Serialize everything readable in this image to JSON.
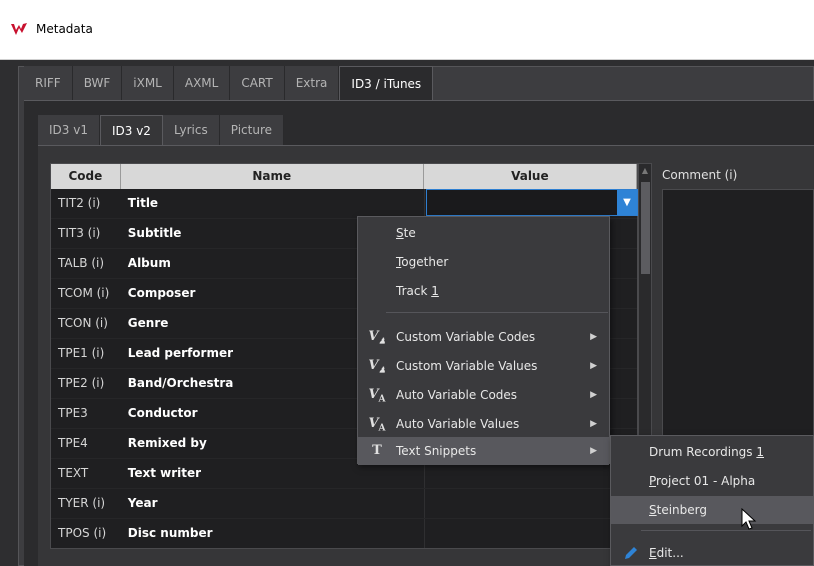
{
  "window": {
    "title": "Metadata"
  },
  "tabs": [
    "RIFF",
    "BWF",
    "iXML",
    "AXML",
    "CART",
    "Extra",
    "ID3 / iTunes"
  ],
  "active_tab": "ID3 / iTunes",
  "subtabs": [
    "ID3 v1",
    "ID3 v2",
    "Lyrics",
    "Picture"
  ],
  "active_subtab": "ID3 v2",
  "table": {
    "headers": {
      "code": "Code",
      "name": "Name",
      "value": "Value"
    },
    "rows": [
      {
        "code": "TIT2 (i)",
        "name": "Title"
      },
      {
        "code": "TIT3 (i)",
        "name": "Subtitle"
      },
      {
        "code": "TALB (i)",
        "name": "Album"
      },
      {
        "code": "TCOM (i)",
        "name": "Composer"
      },
      {
        "code": "TCON (i)",
        "name": "Genre"
      },
      {
        "code": "TPE1 (i)",
        "name": "Lead performer"
      },
      {
        "code": "TPE2 (i)",
        "name": "Band/Orchestra"
      },
      {
        "code": "TPE3",
        "name": "Conductor"
      },
      {
        "code": "TPE4",
        "name": "Remixed by"
      },
      {
        "code": "TEXT",
        "name": "Text writer"
      },
      {
        "code": "TYER (i)",
        "name": "Year"
      },
      {
        "code": "TPOS (i)",
        "name": "Disc number"
      }
    ]
  },
  "comment": {
    "label": "Comment (i)"
  },
  "menu": {
    "recent": [
      {
        "pre": "",
        "ul": "S",
        "post": "te"
      },
      {
        "pre": "",
        "ul": "T",
        "post": "ogether"
      },
      {
        "pre": "Track ",
        "ul": "1",
        "post": ""
      }
    ],
    "items": [
      {
        "label": "Custom Variable Codes",
        "icon": "custom-variable-icon"
      },
      {
        "label": "Custom Variable Values",
        "icon": "custom-variable-icon"
      },
      {
        "label": "Auto Variable Codes",
        "icon": "auto-variable-icon"
      },
      {
        "label": "Auto Variable Values",
        "icon": "auto-variable-icon"
      },
      {
        "label": "Text Snippets",
        "icon": "text-icon"
      }
    ]
  },
  "submenu": {
    "items": [
      {
        "pre": "Drum Recordings ",
        "ul": "1",
        "post": ""
      },
      {
        "pre": "",
        "ul": "P",
        "post": "roject 01 - Alpha"
      },
      {
        "pre": "",
        "ul": "S",
        "post": "teinberg"
      }
    ],
    "edit": {
      "pre": "",
      "ul": "E",
      "post": "dit..."
    }
  },
  "colors": {
    "accent": "#2e83d6",
    "logo": "#c8102e"
  }
}
